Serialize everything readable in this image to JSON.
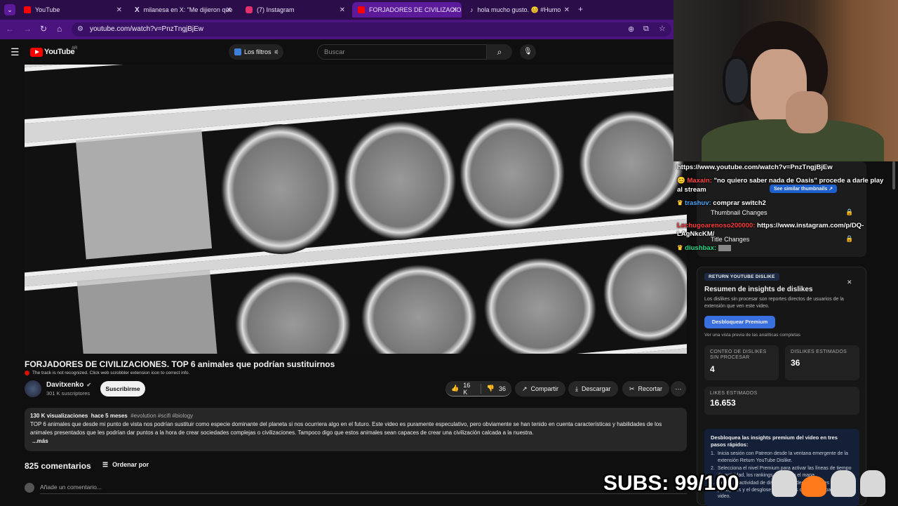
{
  "browser": {
    "tabs": [
      {
        "label": "YouTube",
        "color": "#ff0000"
      },
      {
        "label": "milanesa en X: \"Me dijieron que",
        "color": "#ffffff"
      },
      {
        "label": "(7) Instagram",
        "color": "#e1306c"
      },
      {
        "label": "FORJADORES DE CIVILIZACION",
        "color": "#ff0000"
      },
      {
        "label": "hola mucho gusto. 😊 #Humo",
        "color": "#ffffff"
      }
    ],
    "url": "youtube.com/watch?v=PnzTngjBjEw"
  },
  "youtube": {
    "logo": "YouTube",
    "region": "AR",
    "filter_button": "Los filtros",
    "search_placeholder": "Buscar",
    "video_title": "FORJADORES DE CIVILIZACIONES. TOP 6 animales que podrían sustituirnos",
    "scrobbler_notice": "The track is not recognized. Click web scrobbler extension icon to correct info.",
    "channel_name": "Davitxenko",
    "subscribers": "301 K suscriptores",
    "subscribe_label": "Suscribirme",
    "likes": "16 K",
    "dislikes": "36",
    "share_label": "Compartir",
    "download_label": "Descargar",
    "clip_label": "Recortar",
    "views": "130 K visualizaciones",
    "date": "hace 5 meses",
    "hashtags": "#evolution #scifi #biology",
    "description": "TOP 6 animales que desde mi punto de vista nos podrían sustituir como especie dominante del planeta si nos ocurriera algo en el futuro. Este video es puramente especulativo, pero obviamente se han tenido en cuenta características y habilidades de los animales presentados que les podrían dar puntos a la hora de crear sociedades complejas o civilizaciones. Tampoco digo que estos animales sean capaces de crear una civilización calcada a la nuestra.",
    "more_label": "...más",
    "comments_count": "825 comentarios",
    "sort_label": "Ordenar por",
    "add_comment_placeholder": "Añade un comentario..."
  },
  "side_panel": {
    "see_similar": "See similar thumbnails",
    "thumbnail_changes": "Thumbnail Changes",
    "title_changes": "Title Changes"
  },
  "ryd": {
    "header": "RETURN YOUTUBE DISLIKE",
    "title": "Resumen de insights de dislikes",
    "subtitle": "Los dislikes sin procesar son reportes directos de usuarios de la extensión que ven este video.",
    "unlock_button": "Desbloquear Premium",
    "preview_note": "Ver una vista previa de las analíticas completas",
    "raw_label": "CONTEO DE DISLIKES SIN PROCESAR",
    "raw_value": "4",
    "estimated_label": "DISLIKES ESTIMADOS",
    "estimated_value": "36",
    "likes_label": "LIKES ESTIMADOS",
    "likes_value": "16.653",
    "premium_title": "Desbloquea las insights premium del video en tres pasos rápidos:",
    "steps": [
      "Inicia sesión con Patreon desde la ventana emergente de la extensión Return YouTube Dislike.",
      "Selecciona el nivel Premium para activar las líneas de tiempo de actividad, los rankings por país y el mapa.",
      "Revisa la actividad de dislikes por video, los países principales y el desglose por estados de EE. UU. para cada video."
    ]
  },
  "stream_overlay": {
    "chat": [
      {
        "user": "",
        "user_color": "#ffffff",
        "text": "https://www.youtube.com/watch?v=PnzTngjBjEw"
      },
      {
        "user": "Maxain:",
        "user_color": "#ff4444",
        "text": "\"no quiero saber nada de Oasis\" procede a darle play al stream"
      },
      {
        "user": "trashuv:",
        "user_color": "#4aa8ff",
        "text": "comprar switch2"
      },
      {
        "user": "Lechugoarenoso200000:",
        "user_color": "#ff3b3b",
        "text": "https://www.instagram.com/p/DQ-LAgNkcKM/"
      },
      {
        "user": "diushbax:",
        "user_color": "#2bd98a",
        "text": ""
      }
    ],
    "subs_counter": "SUBS: 99/100"
  }
}
